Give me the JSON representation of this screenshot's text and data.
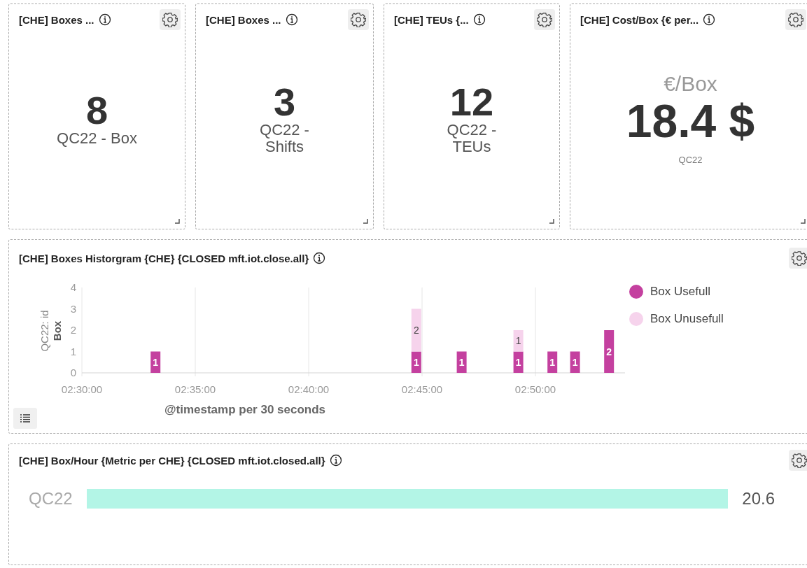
{
  "metric_panels": [
    {
      "kind": "standard",
      "title": "[CHE] Boxes ...",
      "value": "8",
      "label": "QC22 - Box"
    },
    {
      "kind": "standard",
      "title": "[CHE] Boxes ...",
      "value": "3",
      "label": "QC22 -\nShifts"
    },
    {
      "kind": "standard",
      "title": "[CHE] TEUs {...",
      "value": "12",
      "label": "QC22 -\nTEUs"
    },
    {
      "kind": "captioned",
      "title": "[CHE] Cost/Box {€ per...",
      "caption": "€/Box",
      "value": "18.4 $",
      "label": "QC22"
    }
  ],
  "histogram": {
    "title": "[CHE] Boxes Historgram {CHE} {CLOSED mft.iot.close.all}",
    "y_axis_group": "Box",
    "chart_data": {
      "type": "bar",
      "stacked": true,
      "data_labels": true,
      "xlabel": "@timestamp per 30 seconds",
      "ylabel": "QC22: id",
      "categories": [
        "02:30:00",
        null,
        null,
        null,
        null,
        null,
        null,
        null,
        null,
        null,
        "02:35:00",
        null,
        null,
        null,
        null,
        null,
        null,
        null,
        null,
        null,
        "02:40:00",
        null,
        null,
        null,
        null,
        null,
        null,
        null,
        null,
        null,
        "02:45:00",
        null,
        null,
        null,
        null,
        null,
        null,
        null,
        null,
        null,
        "02:50:00",
        null,
        null,
        null,
        null,
        null,
        null,
        null
      ],
      "series": [
        {
          "name": "Box Usefull",
          "color": "#c4409f",
          "values": [
            null,
            null,
            null,
            null,
            null,
            null,
            1,
            null,
            null,
            null,
            null,
            null,
            null,
            null,
            null,
            null,
            null,
            null,
            null,
            null,
            null,
            null,
            null,
            null,
            null,
            null,
            null,
            null,
            null,
            1,
            null,
            null,
            null,
            1,
            null,
            null,
            null,
            null,
            1,
            null,
            null,
            1,
            null,
            1,
            null,
            null,
            2,
            null
          ]
        },
        {
          "name": "Box Unusefull",
          "color": "#f6d3ec",
          "values": [
            null,
            null,
            null,
            null,
            null,
            null,
            null,
            null,
            null,
            null,
            null,
            null,
            null,
            null,
            null,
            null,
            null,
            null,
            null,
            null,
            null,
            null,
            null,
            null,
            null,
            null,
            null,
            null,
            null,
            2,
            null,
            null,
            null,
            null,
            null,
            null,
            null,
            null,
            1,
            null,
            null,
            null,
            null,
            null,
            null,
            null,
            null,
            null
          ]
        }
      ],
      "ylim": [
        0,
        4
      ],
      "grid": true,
      "yticks": [
        0,
        1,
        2,
        3,
        4
      ]
    }
  },
  "box_hour": {
    "title": "[CHE] Box/Hour {Metric per CHE} {CLOSED mft.iot.closed.all}",
    "rows": [
      {
        "label": "QC22",
        "value": "20.6",
        "color": "#b3f5e6"
      }
    ]
  }
}
